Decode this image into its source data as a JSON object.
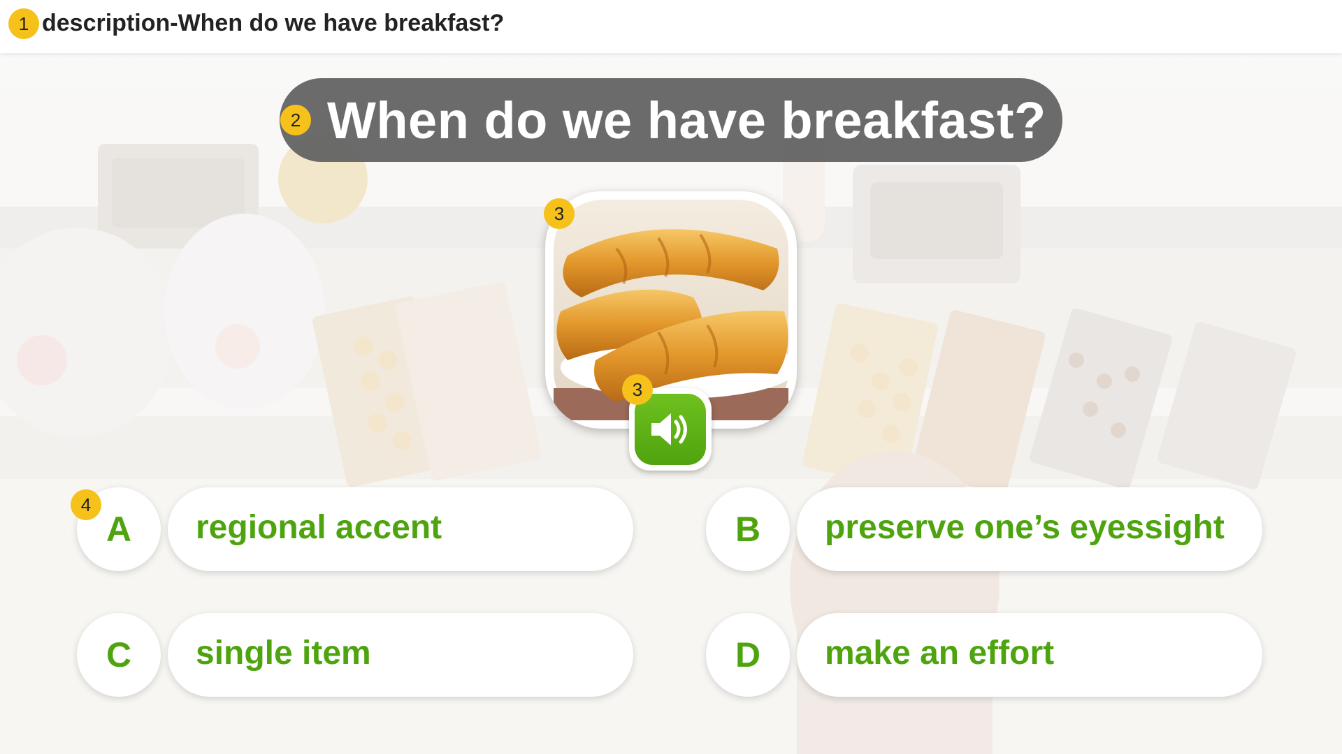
{
  "header": {
    "marker": "1",
    "title": "description-When do we have breakfast?"
  },
  "question": {
    "marker": "2",
    "text": "When do we have breakfast?"
  },
  "picture": {
    "marker": "3",
    "icon": "bread-icon"
  },
  "audio": {
    "marker": "3",
    "icon": "speaker-icon"
  },
  "options": [
    {
      "letter": "A",
      "text": "regional accent",
      "marker": "4"
    },
    {
      "letter": "B",
      "text": "preserve one’s eyessight"
    },
    {
      "letter": "C",
      "text": "single item"
    },
    {
      "letter": "D",
      "text": "make an effort"
    }
  ],
  "colors": {
    "accent_green": "#4ea40f",
    "marker_yellow": "#f5c11a",
    "banner_gray": "#606060"
  }
}
